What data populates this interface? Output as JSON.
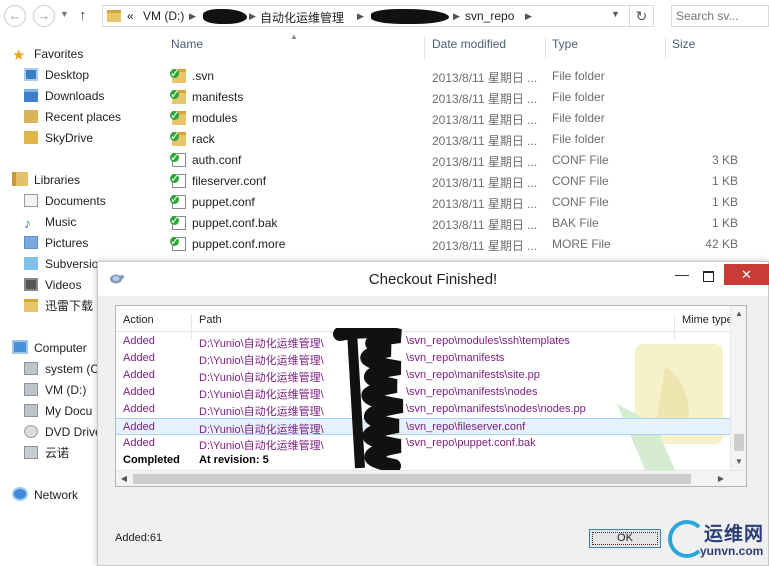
{
  "explorer": {
    "address": {
      "overflow": "«",
      "segments": [
        "VM (D:)",
        "自动化运维管理",
        "svn_repo"
      ]
    },
    "search_placeholder": "Search sv...",
    "favorites": {
      "header": "Favorites",
      "items": [
        "Desktop",
        "Downloads",
        "Recent places",
        "SkyDrive"
      ]
    },
    "libraries": {
      "header": "Libraries",
      "items": [
        "Documents",
        "Music",
        "Pictures",
        "Subversio",
        "Videos",
        "迅雷下载"
      ]
    },
    "computer": {
      "header": "Computer",
      "items": [
        "system (C",
        "VM (D:)",
        "My Docu",
        "DVD Drive",
        "云诺"
      ]
    },
    "network": {
      "header": "Network"
    },
    "columns": {
      "name": "Name",
      "date": "Date modified",
      "type": "Type",
      "size": "Size"
    },
    "files": [
      {
        "name": ".svn",
        "date": "2013/8/11 星期日 ...",
        "type": "File folder",
        "size": ""
      },
      {
        "name": "manifests",
        "date": "2013/8/11 星期日 ...",
        "type": "File folder",
        "size": ""
      },
      {
        "name": "modules",
        "date": "2013/8/11 星期日 ...",
        "type": "File folder",
        "size": ""
      },
      {
        "name": "rack",
        "date": "2013/8/11 星期日 ...",
        "type": "File folder",
        "size": ""
      },
      {
        "name": "auth.conf",
        "date": "2013/8/11 星期日 ...",
        "type": "CONF File",
        "size": "3 KB"
      },
      {
        "name": "fileserver.conf",
        "date": "2013/8/11 星期日 ...",
        "type": "CONF File",
        "size": "1 KB"
      },
      {
        "name": "puppet.conf",
        "date": "2013/8/11 星期日 ...",
        "type": "CONF File",
        "size": "1 KB"
      },
      {
        "name": "puppet.conf.bak",
        "date": "2013/8/11 星期日 ...",
        "type": "BAK File",
        "size": "1 KB"
      },
      {
        "name": "puppet.conf.more",
        "date": "2013/8/11 星期日 ...",
        "type": "MORE File",
        "size": "42 KB"
      }
    ]
  },
  "dialog": {
    "title": "Checkout Finished!",
    "columns": {
      "action": "Action",
      "path": "Path",
      "mime": "Mime type"
    },
    "rows": [
      {
        "action": "Added",
        "path": "D:\\Yunio\\自动化运维管理\\",
        "tail": "\\svn_repo\\modules\\ssh\\templates"
      },
      {
        "action": "Added",
        "path": "D:\\Yunio\\自动化运维管理\\",
        "tail": "\\svn_repo\\manifests"
      },
      {
        "action": "Added",
        "path": "D:\\Yunio\\自动化运维管理\\",
        "tail": "\\svn_repo\\manifests\\site.pp"
      },
      {
        "action": "Added",
        "path": "D:\\Yunio\\自动化运维管理\\",
        "tail": "\\svn_repo\\manifests\\nodes"
      },
      {
        "action": "Added",
        "path": "D:\\Yunio\\自动化运维管理\\",
        "tail": "\\svn_repo\\manifests\\nodes\\nodes.pp"
      },
      {
        "action": "Added",
        "path": "D:\\Yunio\\自动化运维管理\\",
        "tail": "\\svn_repo\\fileserver.conf"
      },
      {
        "action": "Added",
        "path": "D:\\Yunio\\自动化运维管理\\",
        "tail": "\\svn_repo\\puppet.conf.bak"
      }
    ],
    "completed": {
      "action": "Completed",
      "path": "At revision: 5"
    },
    "added_summary": "Added:61",
    "ok_label": "OK",
    "minimize": "—",
    "close": "✕"
  },
  "watermark": {
    "cn": "运维网",
    "en": "yunvn.com"
  },
  "colors": {
    "added_text": "#7c1f80",
    "close_button": "#c73c37",
    "header_text": "#4c607a",
    "selected_row": "#e6f2fb",
    "brand_blue": "#2c3e75"
  },
  "icons": {
    "back": "arrow-left-icon",
    "forward": "arrow-right-icon",
    "up": "arrow-up-icon",
    "refresh": "refresh-icon",
    "favorites": "star-icon",
    "svn_ok": "green-check-overlay-icon"
  }
}
